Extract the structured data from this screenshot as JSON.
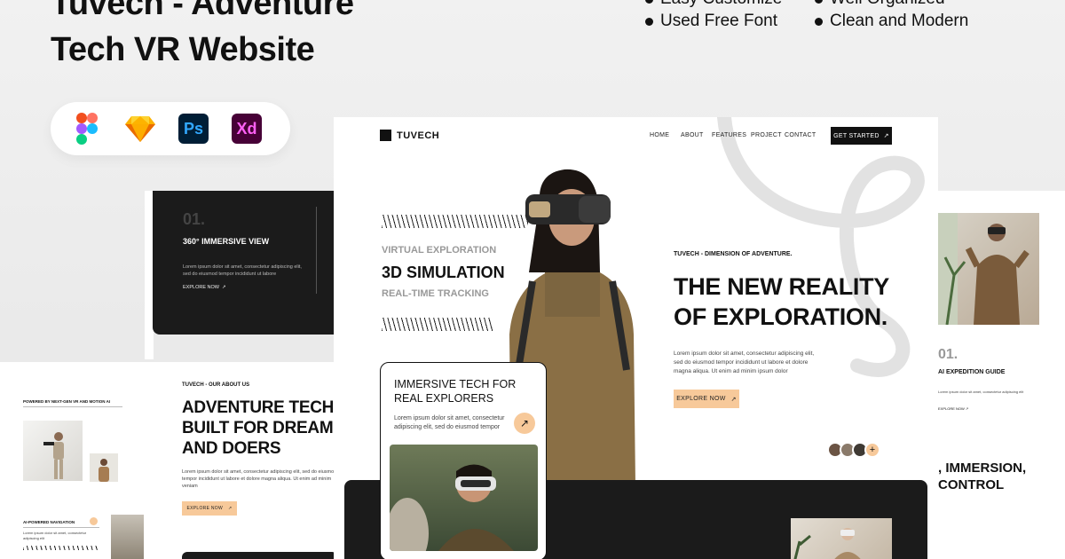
{
  "hero": {
    "title_line1": "Tuvech - Adventure",
    "title_line2": "Tech VR Website"
  },
  "features": [
    {
      "label": "Easy Customize"
    },
    {
      "label": "Well Organized"
    },
    {
      "label": "Used Free Font"
    },
    {
      "label": "Clean and Modern"
    }
  ],
  "tools": [
    {
      "icon": "figma-icon"
    },
    {
      "icon": "sketch-icon"
    },
    {
      "icon": "photoshop-icon",
      "label": "Ps"
    },
    {
      "icon": "adobe-xd-icon",
      "label": "Xd"
    }
  ],
  "site": {
    "logo": "TUVECH",
    "nav": [
      "HOME",
      "ABOUT",
      "FEATURES",
      "PROJECT",
      "CONTACT"
    ],
    "cta": "GET STARTED",
    "left_list": [
      "VIRTUAL EXPLORATION",
      "3D SIMULATION",
      "REAL-TIME TRACKING"
    ],
    "eyebrow": "TUVECH - DIMENSION OF ADVENTURE.",
    "headline_1": "THE NEW REALITY",
    "headline_2": "OF EXPLORATION.",
    "body": "Lorem ipsum dolor sit amet, consectetur adipiscing elit, sed do eiusmod tempor incididunt ut labore et dolore magna aliqua. Ut enim ad minim ipsum dolor",
    "explore": "EXPLORE NOW",
    "card_title_1": "IMMERSIVE TECH FOR",
    "card_title_2": "REAL EXPLORERS",
    "card_body": "Lorem ipsum dolor sit amet, consectetur adipiscing elit, sed do eiusmod tempor",
    "avatars_plus": "+"
  },
  "dark_card": {
    "number": "01.",
    "title": "360° IMMERSIVE VIEW",
    "body": "Lorem ipsum dolor sit amet, consectetur adipiscing elit, sed do eiusmod tempor incididunt ut labore",
    "link": "EXPLORE NOW"
  },
  "about": {
    "eyebrow": "TUVECH - OUR ABOUT US",
    "title_1": "ADVENTURE TECH",
    "title_2": "BUILT FOR DREAMERS",
    "title_3": "AND DOERS",
    "body": "Lorem ipsum dolor sit amet, consectetur adipiscing elit, sed do eiusmod tempor incididunt ut labore et dolore magna aliqua. Ut enim ad minim veniam",
    "explore": "EXPLORE NOW",
    "powered": "POWERED BY NEXT-GEN VR AND MOTION AI",
    "nav_label": "AI-POWERED NAVIGATION"
  },
  "right_panel": {
    "number": "01.",
    "title": "AI EXPEDITION GUIDE",
    "body": "Lorem ipsum dolor sit amet, consectetur adipiscing elit",
    "link": "EXPLORE NOW",
    "tagline_1": ", IMMERSION,",
    "tagline_2": "CONTROL"
  }
}
